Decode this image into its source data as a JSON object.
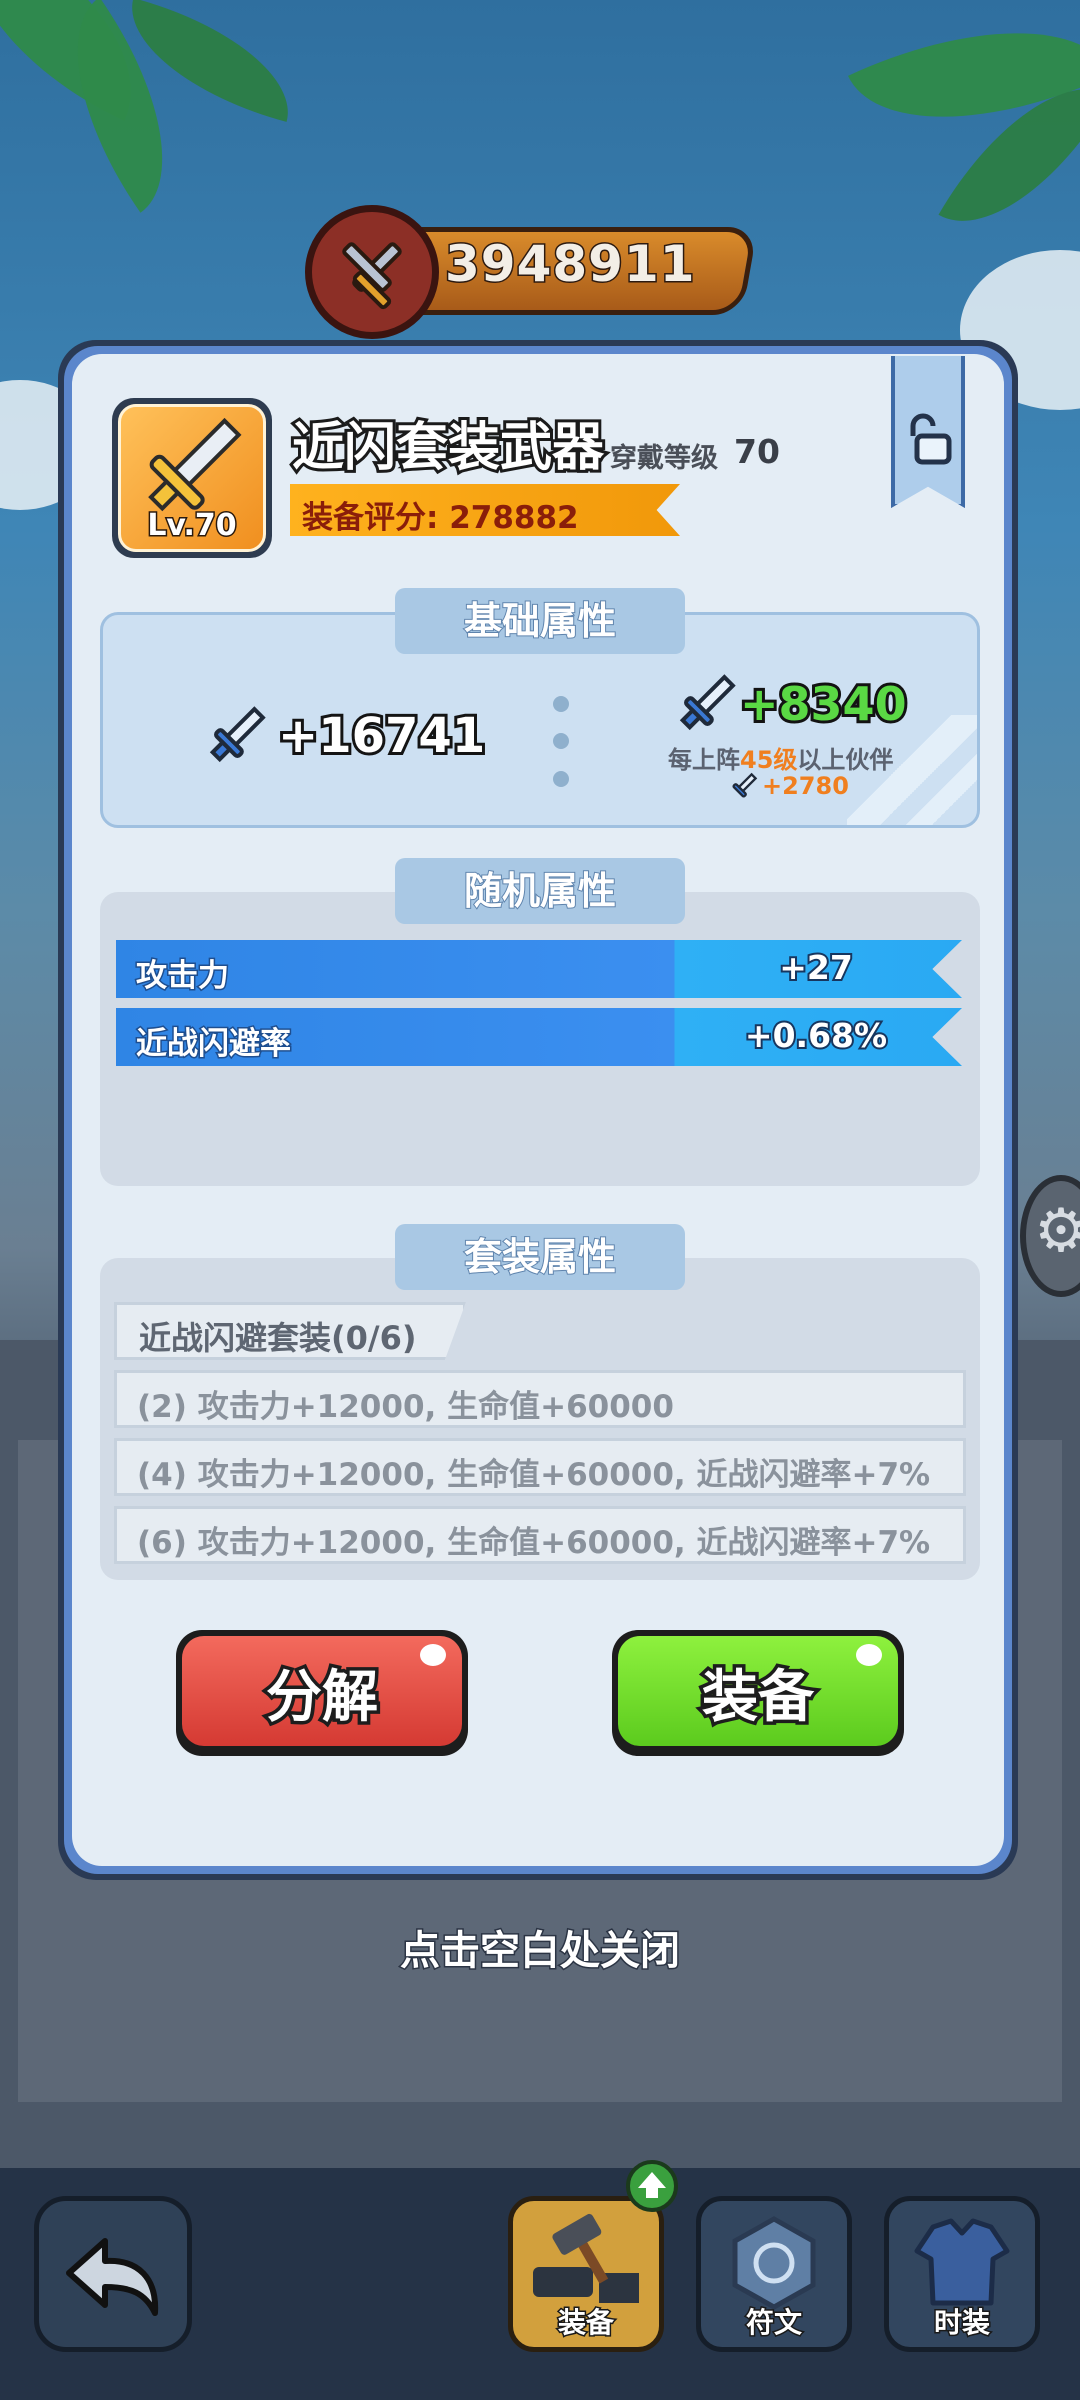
{
  "power": {
    "value": "3948911",
    "icon": "crossed-swords-icon"
  },
  "item": {
    "name": "近闪套装武器",
    "level_badge": "Lv.70",
    "wear_level_label": "穿戴等级",
    "wear_level_value": "70",
    "score_label": "装备评分: 278882",
    "lock_icon": "unlock-icon",
    "icon": "sword-icon"
  },
  "base_attributes": {
    "title": "基础属性",
    "left_value": "+16741",
    "right_value": "+8340",
    "partner_note_prefix": "每上阵",
    "partner_note_level": "45级",
    "partner_note_suffix": "以上伙伴",
    "partner_bonus": "+2780"
  },
  "random_attributes": {
    "title": "随机属性",
    "rows": [
      {
        "label": "攻击力",
        "value": "+27"
      },
      {
        "label": "近战闪避率",
        "value": "+0.68%"
      }
    ]
  },
  "set_attributes": {
    "title": "套装属性",
    "set_name": "近战闪避套装(0/6)",
    "bonuses": [
      "(2) 攻击力+12000, 生命值+60000",
      "(4) 攻击力+12000, 生命值+60000, 近战闪避率+7%",
      "(6) 攻击力+12000, 生命值+60000, 近战闪避率+7%"
    ]
  },
  "actions": {
    "decompose": "分解",
    "equip": "装备"
  },
  "close_hint": "点击空白处关闭",
  "bottom_nav": {
    "back_icon": "back-arrow-icon",
    "tabs": [
      {
        "label": "装备",
        "icon": "anvil-hammer-icon",
        "active": true
      },
      {
        "label": "符文",
        "icon": "rune-icon",
        "active": false
      },
      {
        "label": "时装",
        "icon": "costume-icon",
        "active": false
      }
    ]
  },
  "colors": {
    "equip_green": "#6fd92a",
    "decompose_red": "#e0493f",
    "score_orange": "#ffb21e",
    "stat_blue": "#2f85e5"
  }
}
